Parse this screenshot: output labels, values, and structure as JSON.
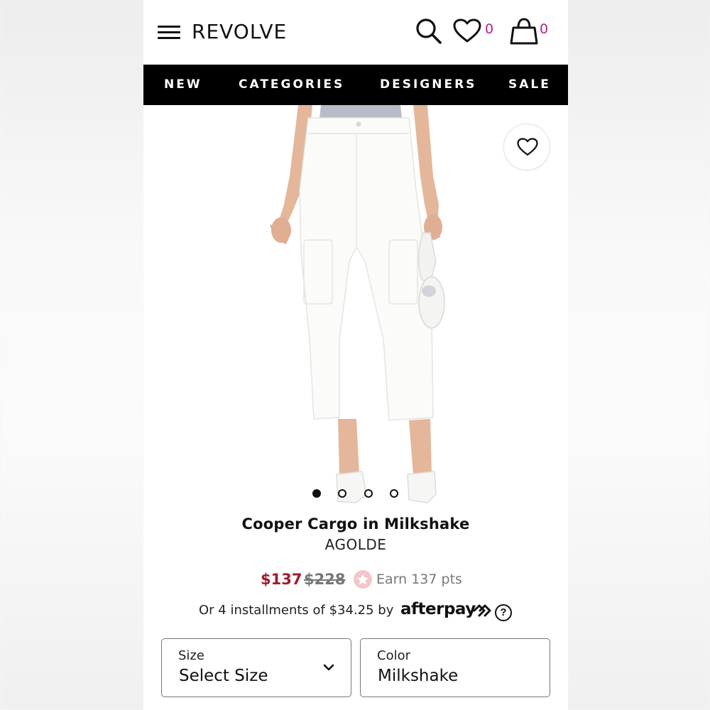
{
  "header": {
    "logo": "REVOLVE",
    "wishlist_count": "0",
    "bag_count": "0",
    "icons": [
      "menu-icon",
      "search-icon",
      "heart-icon",
      "shopping-bag-icon"
    ]
  },
  "nav": {
    "items": [
      {
        "label": "NEW"
      },
      {
        "label": "CATEGORIES"
      },
      {
        "label": "DESIGNERS"
      },
      {
        "label": "SALE"
      }
    ]
  },
  "gallery": {
    "image_count": 4,
    "active_index": 0
  },
  "product": {
    "title": "Cooper Cargo in Milkshake",
    "brand": "AGOLDE",
    "sale_price": "$137",
    "original_price": "$228",
    "points": "Earn 137 pts",
    "installments": "Or 4 installments of $34.25 by",
    "afterpay": "afterpay"
  },
  "options": {
    "size": {
      "label": "Size",
      "value": "Select Size"
    },
    "color": {
      "label": "Color",
      "value": "Milkshake"
    }
  },
  "colors": {
    "accent_count": "#b3208f",
    "sale_price": "#a01c2e",
    "nav_bg": "#000000",
    "points_badge": "#f3c6cc"
  }
}
